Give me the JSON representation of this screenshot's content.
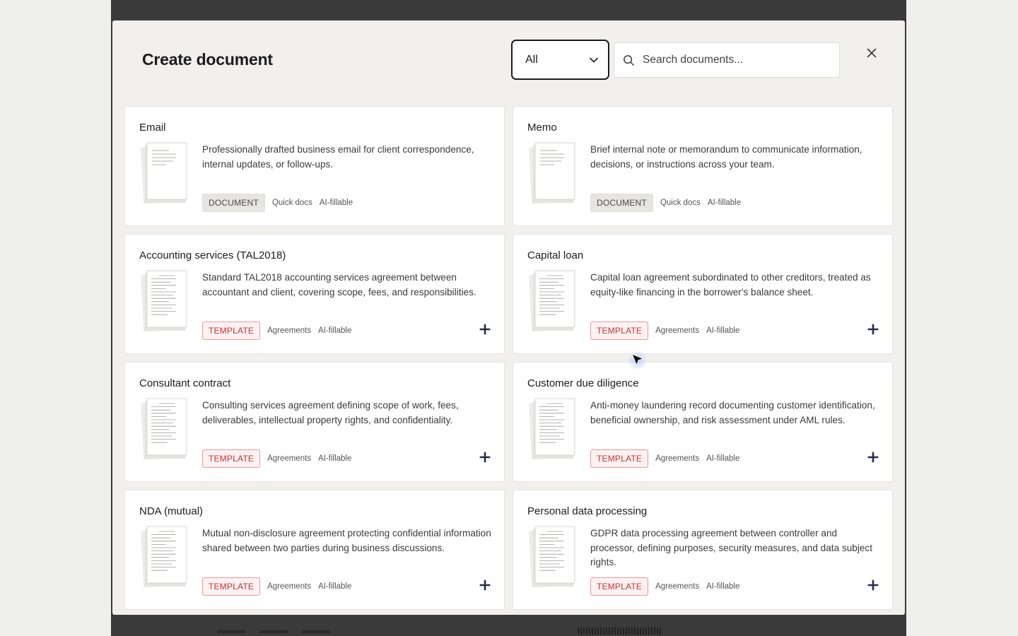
{
  "modal": {
    "title": "Create document",
    "filter": {
      "selected": "All"
    },
    "search": {
      "placeholder": "Search documents..."
    }
  },
  "cards": [
    {
      "title": "Email",
      "description": "Professionally drafted business email for client correspondence, internal updates, or follow-ups.",
      "badge": "DOCUMENT",
      "category": "Quick docs",
      "ai": "AI-fillable"
    },
    {
      "title": "Memo",
      "description": "Brief internal note or memorandum to communicate information, decisions, or instructions across your team.",
      "badge": "DOCUMENT",
      "category": "Quick docs",
      "ai": "AI-fillable"
    },
    {
      "title": "Accounting services (TAL2018)",
      "description": "Standard TAL2018 accounting services agreement between accountant and client, covering scope, fees, and responsibilities.",
      "badge": "TEMPLATE",
      "category": "Agreements",
      "ai": "AI-fillable"
    },
    {
      "title": "Capital loan",
      "description": "Capital loan agreement subordinated to other creditors, treated as equity-like financing in the borrower's balance sheet.",
      "badge": "TEMPLATE",
      "category": "Agreements",
      "ai": "AI-fillable"
    },
    {
      "title": "Consultant contract",
      "description": "Consulting services agreement defining scope of work, fees, deliverables, intellectual property rights, and confidentiality.",
      "badge": "TEMPLATE",
      "category": "Agreements",
      "ai": "AI-fillable"
    },
    {
      "title": "Customer due diligence",
      "description": "Anti-money laundering record documenting customer identification, beneficial ownership, and risk assessment under AML rules.",
      "badge": "TEMPLATE",
      "category": "Agreements",
      "ai": "AI-fillable"
    },
    {
      "title": "NDA (mutual)",
      "description": "Mutual non-disclosure agreement protecting confidential information shared between two parties during business discussions.",
      "badge": "TEMPLATE",
      "category": "Agreements",
      "ai": "AI-fillable"
    },
    {
      "title": "Personal data processing",
      "description": "GDPR data processing agreement between controller and processor, defining purposes, security measures, and data subject rights.",
      "badge": "TEMPLATE",
      "category": "Agreements",
      "ai": "AI-fillable"
    }
  ],
  "icons": {
    "filter": "chevron-down-icon",
    "search": "search-icon",
    "close": "close-icon",
    "add": "plus-icon",
    "thumbnail": "document-thumbnail-icon",
    "cursor": "mouse-cursor-icon"
  },
  "colors": {
    "template_badge_text": "#c2333b",
    "template_badge_border": "#e79aa0",
    "add_icon": "#1f2f4d",
    "modal_background": "#f1f0ed"
  }
}
